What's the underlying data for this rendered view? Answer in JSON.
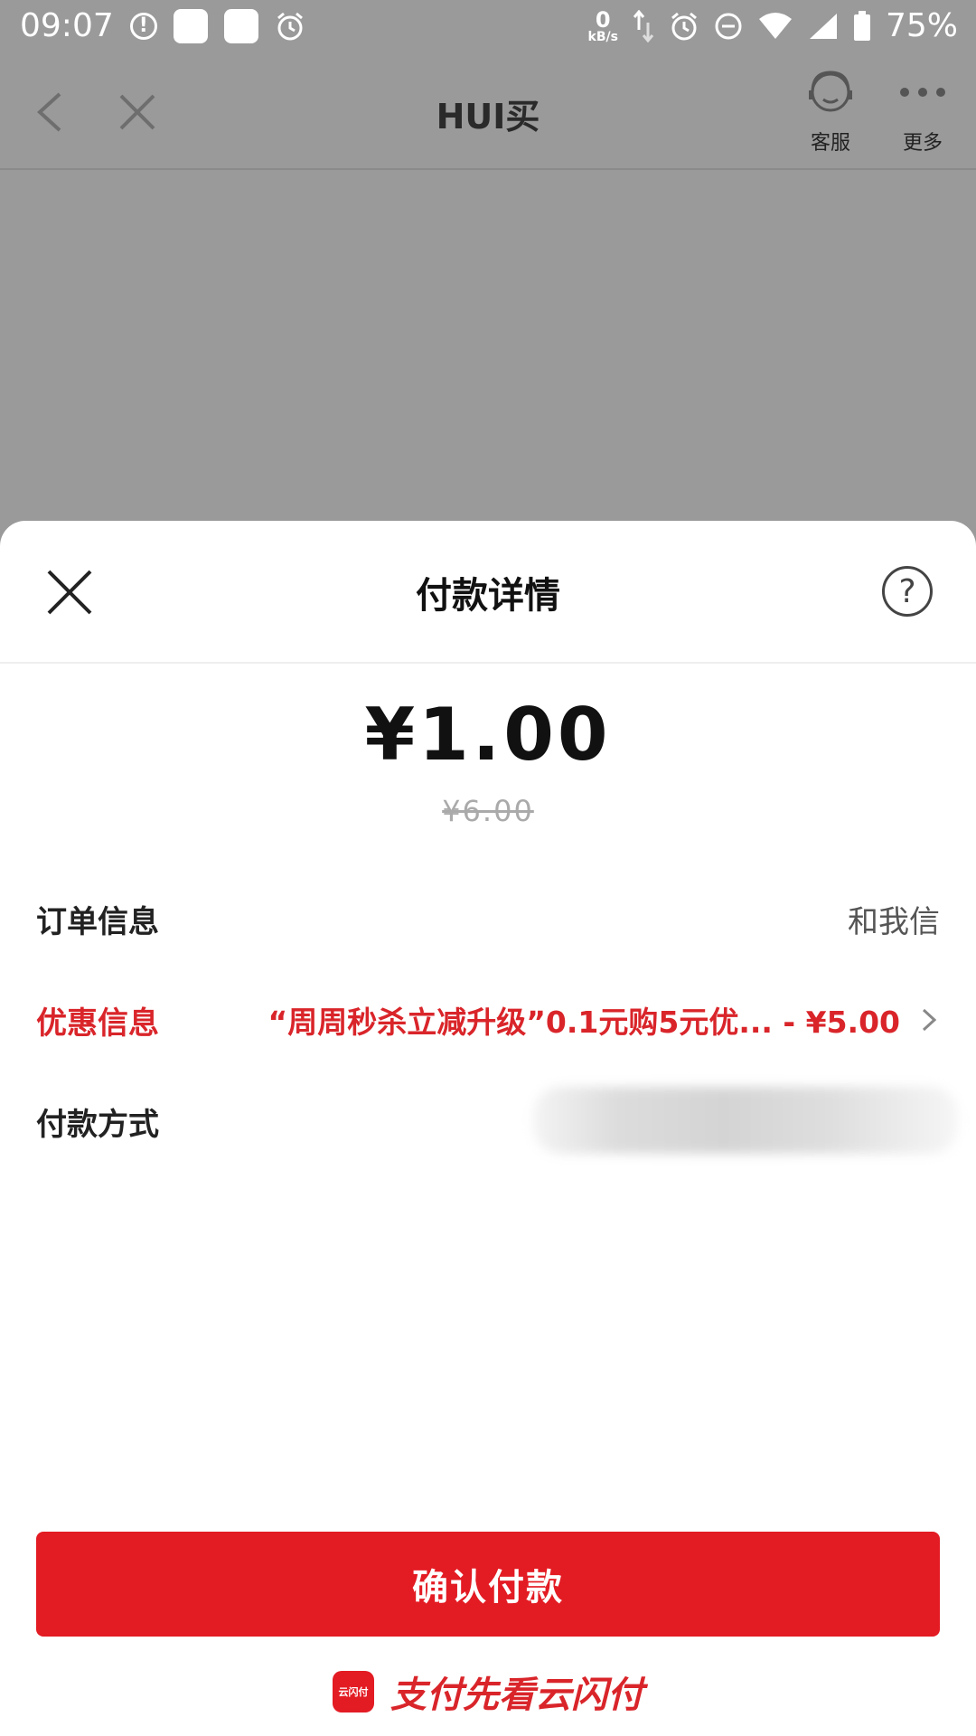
{
  "status_bar": {
    "time": "09:07",
    "net_speed_value": "0",
    "net_speed_unit": "kB/s",
    "battery": "75%"
  },
  "app_bar": {
    "title": "HUI买",
    "service_label": "客服",
    "more_label": "更多"
  },
  "sheet": {
    "title": "付款详情",
    "help_symbol": "?",
    "amount": "¥1.00",
    "original_price": "¥6.00",
    "rows": {
      "order": {
        "label": "订单信息",
        "value": "和我信"
      },
      "discount": {
        "label": "优惠信息",
        "value": "“周周秒杀立减升级”0.1元购5元优... - ¥5.00"
      },
      "payment": {
        "label": "付款方式"
      }
    },
    "confirm_label": "确认付款",
    "footer_logo_text": "云闪付",
    "footer_slogan": "支付先看云闪付"
  },
  "colors": {
    "accent": "#e31b23",
    "discount_text": "#d9252a",
    "overlay": "#9a9a9a"
  }
}
